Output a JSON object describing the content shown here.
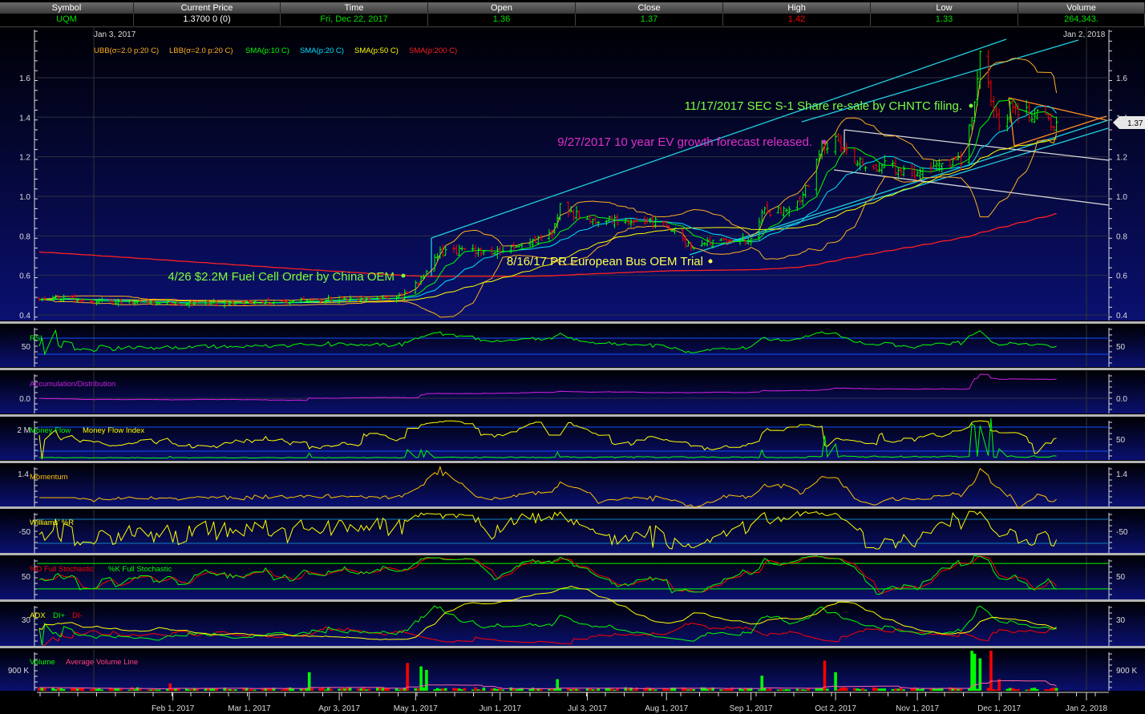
{
  "quote": {
    "headers": [
      "Symbol",
      "Current Price",
      "Time",
      "Open",
      "Close",
      "High",
      "Low",
      "Volume"
    ],
    "symbol": "UQM",
    "current_price": "1.3700  0 (0)",
    "time": "Fri, Dec 22, 2017",
    "open": "1.36",
    "close": "1.37",
    "high": "1.42",
    "low": "1.33",
    "volume": "264,343."
  },
  "colors": {
    "up": "#00ff00",
    "down": "#ff0000",
    "ubb": "#ffb020",
    "lbb": "#ffb020",
    "sma10": "#00ff00",
    "sma20": "#00e0ff",
    "sma50": "#ffff00",
    "sma200": "#ff2020",
    "high_value": "#ff0000"
  },
  "main": {
    "start_date_label": "Jan 3, 2017",
    "end_date_label": "Jan 2, 2018",
    "legend": [
      "UBB(σ=2.0 p:20 C)",
      "LBB(σ=2.0 p:20 C)",
      "SMA(p:10 C)",
      "SMA(p:20 C)",
      "SMA(p:50 C)",
      "SMA(p:200 C)"
    ],
    "price_ticks": [
      "0.4",
      "0.6",
      "0.8",
      "1.0",
      "1.2",
      "1.4",
      "1.6"
    ],
    "last_price_tag": "1.37",
    "annotations": [
      {
        "text": "11/17/2017 SEC S-1 Share re-sale by CHNTC filing.",
        "color": "#7cff3c"
      },
      {
        "text": "9/27/2017 10 year EV growth forecast released.",
        "color": "#e030c8"
      },
      {
        "text": "8/16/17 PR European Bus OEM Trial",
        "color": "#ffff50"
      },
      {
        "text": "4/26 $2.2M Fuel Cell Order by China OEM",
        "color": "#7cff3c"
      }
    ]
  },
  "panels": {
    "rsi": {
      "labels": [
        "RSI"
      ],
      "tick": "50"
    },
    "ad": {
      "labels": [
        "Accumulation/Distribution"
      ],
      "tick": "0.0"
    },
    "mf": {
      "labels": [
        "Money Flow",
        "Money Flow Index"
      ],
      "tick_left": "2 M",
      "tick_right": "50"
    },
    "momentum": {
      "labels": [
        "Momentum"
      ],
      "tick": "1.4"
    },
    "williams": {
      "labels": [
        "Williams' %R"
      ],
      "tick": "-50"
    },
    "stochastic": {
      "labels": [
        "%D Full Stochastic",
        "%K Full Stochastic"
      ],
      "tick": "50"
    },
    "adx": {
      "labels": [
        "ADX",
        "DI+",
        "DI-"
      ],
      "tick": "30"
    },
    "volume": {
      "labels": [
        "Volume",
        "Average Volume Line"
      ],
      "tick": "900 K"
    }
  },
  "x_axis": {
    "labels": [
      {
        "date": "2017-02-01",
        "text": "Feb 1, 2017"
      },
      {
        "date": "2017-03-01",
        "text": "Mar 1, 2017"
      },
      {
        "date": "2017-04-03",
        "text": "Apr 3, 2017"
      },
      {
        "date": "2017-05-01",
        "text": "May 1, 2017"
      },
      {
        "date": "2017-06-01",
        "text": "Jun 1, 2017"
      },
      {
        "date": "2017-07-03",
        "text": "Jul 3, 2017"
      },
      {
        "date": "2017-08-01",
        "text": "Aug 1, 2017"
      },
      {
        "date": "2017-09-01",
        "text": "Sep 1, 2017"
      },
      {
        "date": "2017-10-02",
        "text": "Oct 2, 2017"
      },
      {
        "date": "2017-11-01",
        "text": "Nov 1, 2017"
      },
      {
        "date": "2017-12-01",
        "text": "Dec 1, 2017"
      },
      {
        "date": "2018-01-02",
        "text": "Jan 2, 2018"
      }
    ]
  },
  "chart_data": {
    "type": "line",
    "title": "UQM daily price with indicators",
    "ylim": [
      0.4,
      1.75
    ],
    "price_keyframes": [
      [
        "2016-12-14",
        0.49
      ],
      [
        "2017-01-03",
        0.47
      ],
      [
        "2017-02-01",
        0.46
      ],
      [
        "2017-03-01",
        0.46
      ],
      [
        "2017-04-03",
        0.48
      ],
      [
        "2017-04-26",
        0.49
      ],
      [
        "2017-05-01",
        0.55
      ],
      [
        "2017-05-10",
        0.72
      ],
      [
        "2017-06-01",
        0.72
      ],
      [
        "2017-06-20",
        0.8
      ],
      [
        "2017-06-23",
        0.95
      ],
      [
        "2017-07-03",
        0.88
      ],
      [
        "2017-08-01",
        0.86
      ],
      [
        "2017-08-10",
        0.75
      ],
      [
        "2017-09-01",
        0.78
      ],
      [
        "2017-09-05",
        0.93
      ],
      [
        "2017-09-15",
        0.92
      ],
      [
        "2017-09-22",
        1.05
      ],
      [
        "2017-09-27",
        1.25
      ],
      [
        "2017-10-02",
        1.3
      ],
      [
        "2017-10-10",
        1.18
      ],
      [
        "2017-11-01",
        1.12
      ],
      [
        "2017-11-17",
        1.18
      ],
      [
        "2017-11-22",
        1.45
      ],
      [
        "2017-11-24",
        1.7
      ],
      [
        "2017-12-01",
        1.35
      ],
      [
        "2017-12-05",
        1.45
      ],
      [
        "2017-12-22",
        1.37
      ]
    ],
    "volume_spikes": [
      [
        "2017-01-31",
        320000
      ],
      [
        "2017-03-23",
        800000
      ],
      [
        "2017-04-28",
        1200000
      ],
      [
        "2017-05-03",
        1050000
      ],
      [
        "2017-05-05",
        900000
      ],
      [
        "2017-06-22",
        500000
      ],
      [
        "2017-09-05",
        650000
      ],
      [
        "2017-09-28",
        1300000
      ],
      [
        "2017-10-02",
        800000
      ],
      [
        "2017-11-21",
        1800000
      ],
      [
        "2017-11-22",
        1600000
      ],
      [
        "2017-11-24",
        1400000
      ],
      [
        "2017-11-28",
        1900000
      ],
      [
        "2017-12-01",
        500000
      ]
    ]
  }
}
